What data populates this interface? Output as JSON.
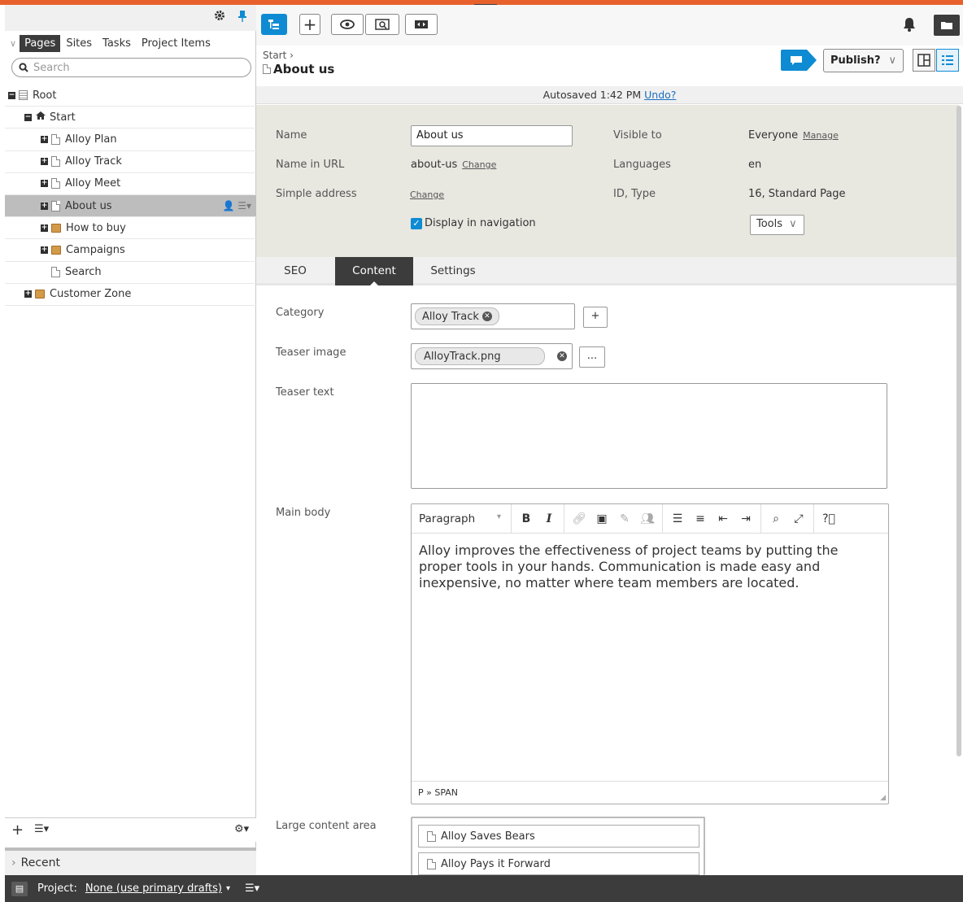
{
  "left_pane": {
    "tabs": [
      "Pages",
      "Sites",
      "Tasks",
      "Project Items"
    ],
    "search_placeholder": "Search",
    "tree": [
      {
        "label": "Root",
        "level": 0,
        "icon": "root-icon",
        "expand": "minus"
      },
      {
        "label": "Start",
        "level": 1,
        "icon": "home-icon",
        "expand": "minus"
      },
      {
        "label": "Alloy Plan",
        "level": 2,
        "icon": "page-icon",
        "expand": "plus"
      },
      {
        "label": "Alloy Track",
        "level": 2,
        "icon": "page-icon",
        "expand": "plus"
      },
      {
        "label": "Alloy Meet",
        "level": 2,
        "icon": "page-icon",
        "expand": "plus"
      },
      {
        "label": "About us",
        "level": 2,
        "icon": "page-icon",
        "expand": "plus",
        "selected": true
      },
      {
        "label": "How to buy",
        "level": 2,
        "icon": "folder-icon",
        "expand": "plus"
      },
      {
        "label": "Campaigns",
        "level": 2,
        "icon": "folder-icon",
        "expand": "plus"
      },
      {
        "label": "Search",
        "level": 2,
        "icon": "page-icon",
        "expand": "none"
      },
      {
        "label": "Customer Zone",
        "level": 1,
        "icon": "folder-icon",
        "expand": "plus"
      }
    ],
    "recent_label": "Recent"
  },
  "status_bar": {
    "project_label": "Project:",
    "project_value": "None (use primary drafts)"
  },
  "header": {
    "breadcrumb": "Start",
    "page_title": "About us",
    "publish_label": "Publish?"
  },
  "autosave": {
    "text": "Autosaved 1:42 PM",
    "undo": "Undo?"
  },
  "properties": {
    "name_label": "Name",
    "name_value": "About us",
    "url_label": "Name in URL",
    "url_value": "about-us",
    "change_label": "Change",
    "simple_label": "Simple address",
    "visible_label": "Visible to",
    "visible_value": "Everyone",
    "manage_label": "Manage",
    "languages_label": "Languages",
    "languages_value": "en",
    "idtype_label": "ID, Type",
    "idtype_value": "16, Standard Page",
    "display_nav_label": "Display in navigation",
    "tools_label": "Tools"
  },
  "content_tabs": [
    "SEO",
    "Content",
    "Settings"
  ],
  "form": {
    "category_label": "Category",
    "category_chip": "Alloy Track",
    "add_label": "+",
    "teaser_image_label": "Teaser image",
    "teaser_image_value": "AlloyTrack.png",
    "browse_label": "...",
    "teaser_text_label": "Teaser text",
    "main_body_label": "Main body",
    "format_select": "Paragraph",
    "body_text": "Alloy improves the effectiveness of project teams by putting the proper tools in your hands. Communication is made easy and inexpensive, no matter where team members are located.",
    "editor_path": "P » SPAN",
    "large_area_label": "Large content area",
    "large_area_items": [
      "Alloy Saves Bears",
      "Alloy Pays it Forward"
    ]
  },
  "colors": {
    "accent_orange": "#e8612c",
    "accent_blue": "#0e8bd3",
    "dark_bar": "#3c3c3c",
    "props_bg": "#e8e7e0"
  }
}
